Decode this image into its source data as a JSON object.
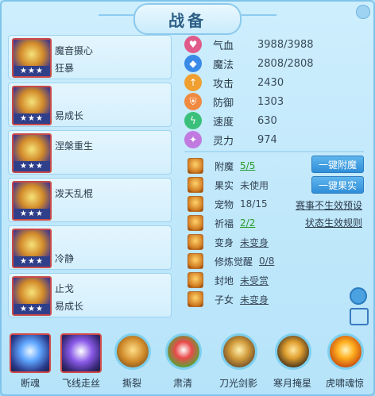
{
  "title": "战备",
  "skills": [
    {
      "line1": "魔音摄心",
      "line2": "狂暴",
      "stars": "★★★"
    },
    {
      "line1": "",
      "line2": "易成长",
      "stars": "★★★"
    },
    {
      "line1": "涅槃重生",
      "line2": "",
      "stars": "★★★"
    },
    {
      "line1": "泼天乱棍",
      "line2": "",
      "stars": "★★★"
    },
    {
      "line1": "",
      "line2": "冷静",
      "stars": "★★★"
    },
    {
      "line1": "止戈",
      "line2": "易成长",
      "stars": "★★★"
    }
  ],
  "stats": [
    {
      "label": "气血",
      "value": "3988/3988",
      "color": "#e05a8a"
    },
    {
      "label": "魔法",
      "value": "2808/2808",
      "color": "#3a8ae8"
    },
    {
      "label": "攻击",
      "value": "2430",
      "color": "#f0a030"
    },
    {
      "label": "防御",
      "value": "1303",
      "color": "#f08a40"
    },
    {
      "label": "速度",
      "value": "630",
      "color": "#3ac07a"
    },
    {
      "label": "灵力",
      "value": "974",
      "color": "#c07ae0"
    }
  ],
  "attrs": [
    {
      "label": "附魔",
      "value": "5/5",
      "style": "green"
    },
    {
      "label": "果实",
      "value": "未使用",
      "style": ""
    },
    {
      "label": "宠物",
      "value": "18/15",
      "style": ""
    },
    {
      "label": "祈福",
      "value": "2/2",
      "style": "green"
    },
    {
      "label": "变身",
      "value": "未变身",
      "style": "ul"
    },
    {
      "label": "修炼觉醒",
      "value": "0/8",
      "style": "ul"
    },
    {
      "label": "封地",
      "value": "未受赏",
      "style": "ul"
    },
    {
      "label": "子女",
      "value": "未变身",
      "style": "ul"
    }
  ],
  "buttons": {
    "enchant": "一键附魔",
    "fruit": "一键果实"
  },
  "links": {
    "preset": "赛事不生效预设",
    "rules": "状态生效规则"
  },
  "bottom_skills": [
    {
      "label": "断魂",
      "kind": "square"
    },
    {
      "label": "飞线走丝",
      "kind": "purple"
    },
    {
      "label": "撕裂",
      "kind": "round"
    },
    {
      "label": "肃清",
      "kind": "round"
    },
    {
      "label": "刀光剑影",
      "kind": "round"
    },
    {
      "label": "寒月掩星",
      "kind": "round"
    },
    {
      "label": "虎啸魂惊",
      "kind": "round"
    }
  ]
}
